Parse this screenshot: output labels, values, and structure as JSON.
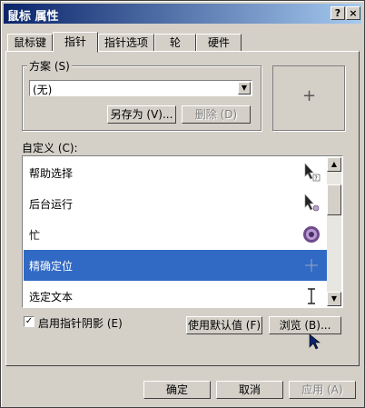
{
  "window": {
    "title": "鼠标 属性",
    "help_button": "?",
    "close_button": "×"
  },
  "tabs": [
    {
      "label": "鼠标键"
    },
    {
      "label": "指针"
    },
    {
      "label": "指针选项"
    },
    {
      "label": "轮"
    },
    {
      "label": "硬件"
    }
  ],
  "scheme": {
    "group_label": "方案 (S)",
    "selected": "(无)",
    "save_as_label": "另存为 (V)...",
    "delete_label": "删除 (D)"
  },
  "customize": {
    "label": "自定义 (C):",
    "items": [
      {
        "label": "帮助选择",
        "icon": "help-select-cursor-icon"
      },
      {
        "label": "后台运行",
        "icon": "working-in-background-cursor-icon"
      },
      {
        "label": "忙",
        "icon": "busy-cursor-icon"
      },
      {
        "label": "精确定位",
        "icon": "precision-select-cursor-icon",
        "selected": true
      },
      {
        "label": "选定文本",
        "icon": "text-select-cursor-icon"
      }
    ]
  },
  "shadow": {
    "label": "启用指针阴影 (E)",
    "checked": true
  },
  "buttons": {
    "use_default": "使用默认值 (F)",
    "browse": "浏览 (B)...",
    "ok": "确定",
    "cancel": "取消",
    "apply": "应用 (A)"
  }
}
